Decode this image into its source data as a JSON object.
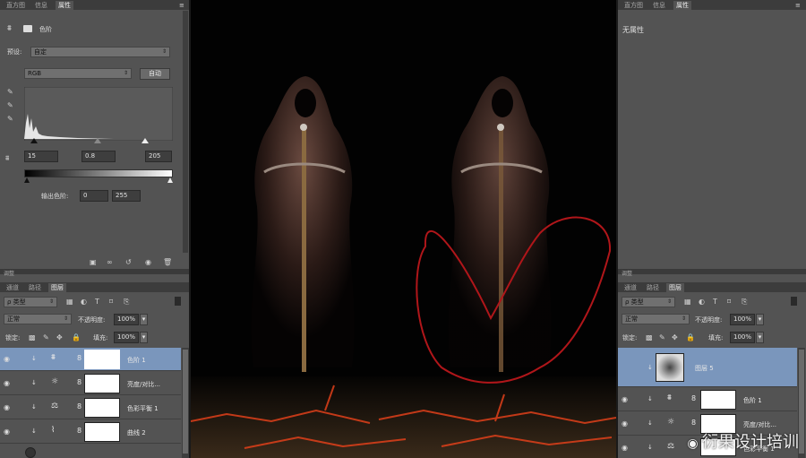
{
  "left_top_panel": {
    "tabs": [
      "直方图",
      "信息",
      "属性"
    ],
    "active_tab": "属性",
    "adj_title": "色阶",
    "preset_label": "预设:",
    "preset_value": "自定",
    "channel_value": "RGB",
    "auto_button": "自动",
    "input_black": "15",
    "input_gamma": "0.8",
    "input_white": "205",
    "output_label": "输出色阶:",
    "output_black": "0",
    "output_white": "255",
    "icons": [
      "clip-to-layer-icon",
      "view-previous-icon",
      "reset-icon",
      "visibility-icon",
      "trash-icon"
    ]
  },
  "left_bottom_panel": {
    "panel_title": "调整",
    "tabs": [
      "通道",
      "路径",
      "图层"
    ],
    "active_tab": "图层",
    "filter_value": "ρ 类型",
    "blend_mode": "正常",
    "opacity_label": "不透明度:",
    "opacity_value": "100%",
    "lock_label": "锁定:",
    "fill_label": "填充:",
    "fill_value": "100%",
    "layers": [
      {
        "name": "色阶 1",
        "icon": "levels-icon",
        "selected": true
      },
      {
        "name": "亮度/对比...",
        "icon": "brightness-icon",
        "selected": false
      },
      {
        "name": "色彩平衡 1",
        "icon": "balance-icon",
        "selected": false
      },
      {
        "name": "曲线 2",
        "icon": "curves-icon",
        "selected": false
      }
    ]
  },
  "right_top_panel": {
    "tabs": [
      "直方图",
      "信息",
      "属性"
    ],
    "active_tab": "属性",
    "no_props": "无属性"
  },
  "right_bottom_panel": {
    "panel_title": "调整",
    "tabs": [
      "通道",
      "路径",
      "图层"
    ],
    "active_tab": "图层",
    "filter_value": "ρ 类型",
    "blend_mode": "正常",
    "opacity_label": "不透明度:",
    "opacity_value": "100%",
    "lock_label": "锁定:",
    "fill_label": "填充:",
    "fill_value": "100%",
    "layers": [
      {
        "name": "图层 5",
        "selected": true
      },
      {
        "name": "色阶 1",
        "selected": false
      },
      {
        "name": "亮度/对比...",
        "selected": false
      },
      {
        "name": "色彩平衡 1",
        "selected": false
      }
    ]
  },
  "watermark": "衍果设计培训",
  "colors": {
    "panel": "#535353",
    "dark": "#3c3c3c",
    "selection": "#7a96bc",
    "heart": "#b0161a",
    "lava": "#e0401a"
  }
}
